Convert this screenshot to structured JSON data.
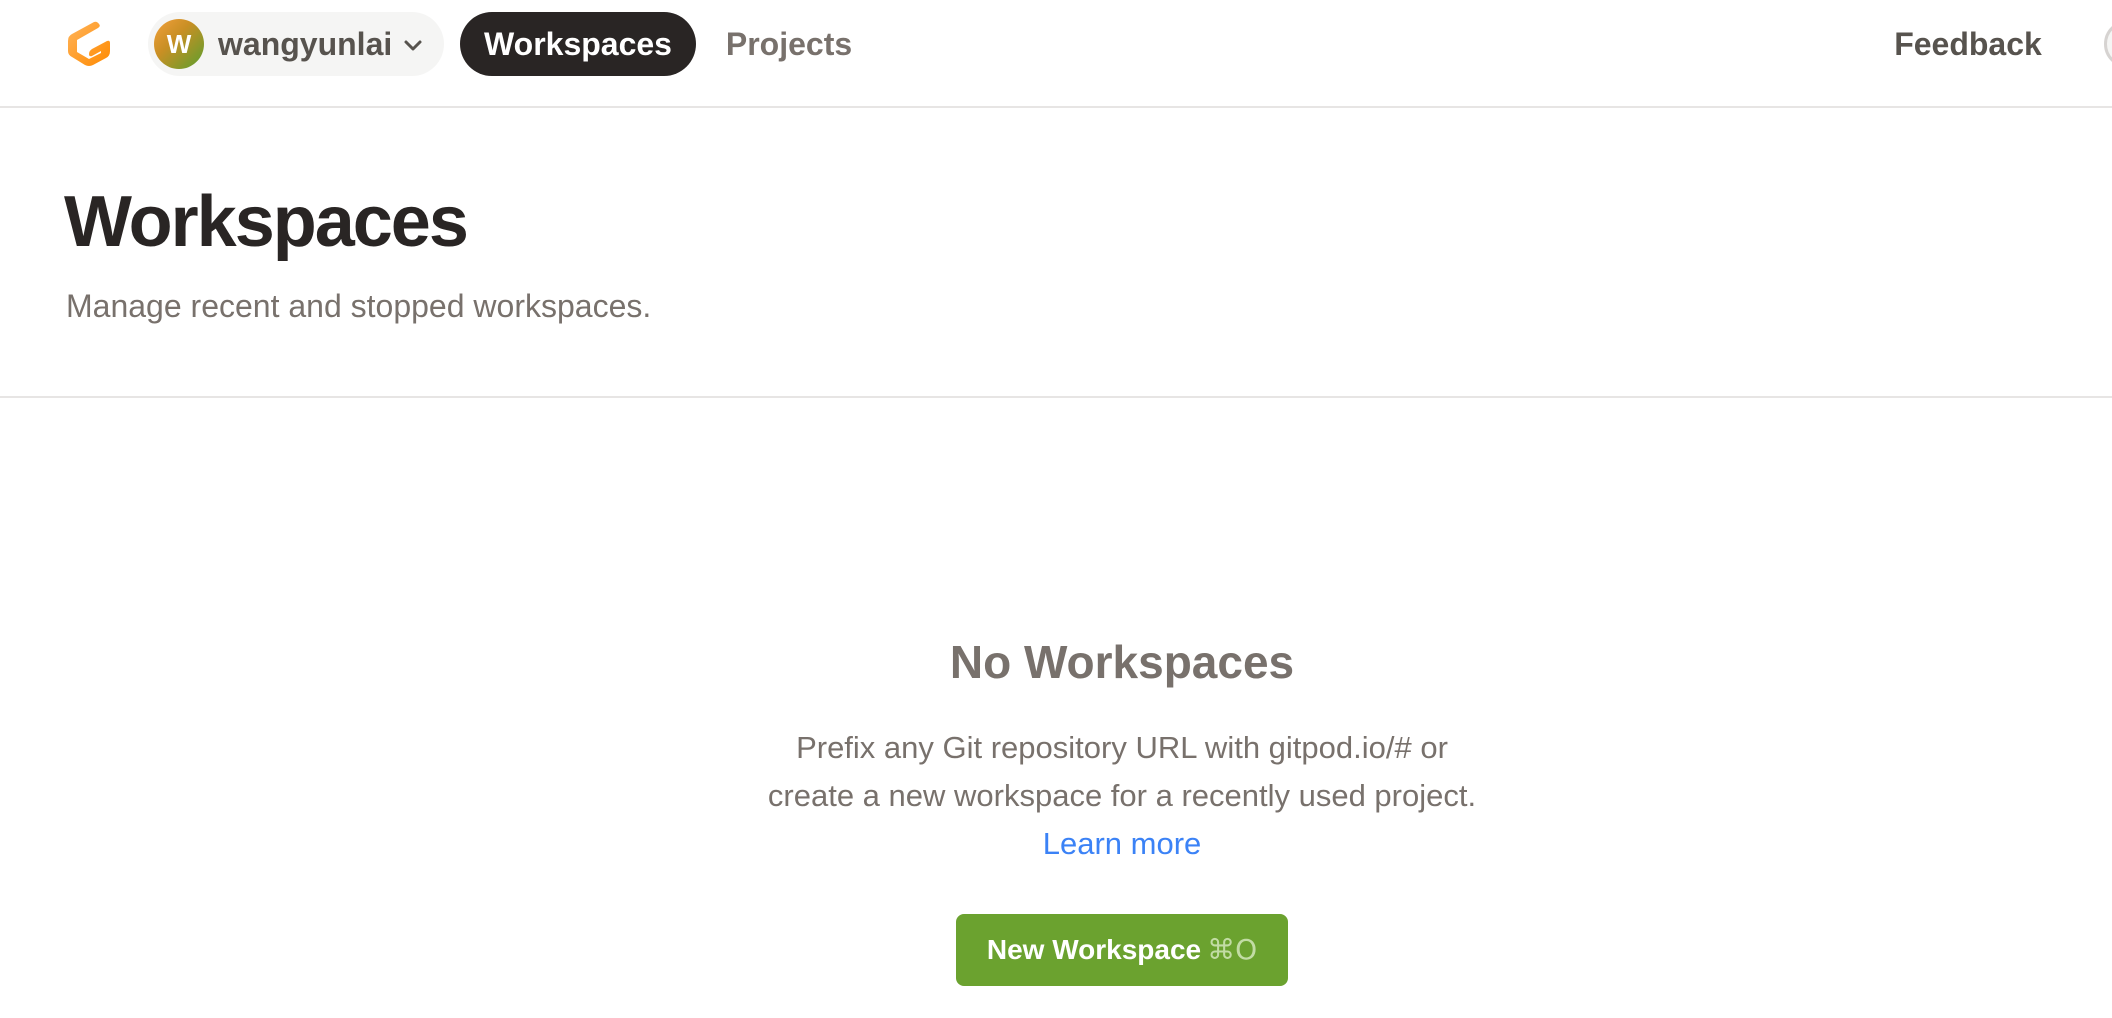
{
  "topbar": {
    "logo_icon": "gitpod-logo-icon",
    "org": {
      "avatar_initial": "W",
      "name": "wangyunlai",
      "chevron_icon": "chevron-down-icon"
    },
    "nav": [
      {
        "label": "Workspaces",
        "active": true
      },
      {
        "label": "Projects",
        "active": false
      }
    ],
    "feedback_label": "Feedback"
  },
  "header": {
    "title": "Workspaces",
    "subtitle": "Manage recent and stopped workspaces."
  },
  "empty_state": {
    "title": "No Workspaces",
    "line1": "Prefix any Git repository URL with gitpod.io/# or",
    "line2": "create a new workspace for a recently used project.",
    "learn_more": "Learn more",
    "button_label": "New Workspace",
    "button_shortcut": "⌘O"
  },
  "colors": {
    "accent_green": "#6ba22f",
    "link_blue": "#3b82f6",
    "logo_orange": "#f59e0b"
  }
}
